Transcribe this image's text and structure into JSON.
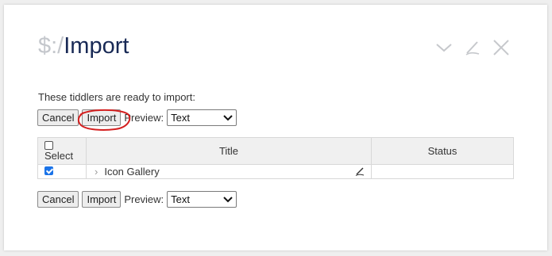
{
  "tiddler": {
    "title_prefix": "$:/",
    "title_name": "Import",
    "intro_text": "These tiddlers are ready to import:"
  },
  "controls": {
    "icons": [
      "chevron-down-icon",
      "edit-icon",
      "close-icon"
    ]
  },
  "toolbar_top": {
    "cancel_label": "Cancel",
    "import_label": "Import",
    "preview_label": "Preview:",
    "preview_value": "Text"
  },
  "toolbar_bottom": {
    "cancel_label": "Cancel",
    "import_label": "Import",
    "preview_label": "Preview:",
    "preview_value": "Text"
  },
  "table": {
    "headers": {
      "select": "Select",
      "title": "Title",
      "status": "Status"
    },
    "rows": [
      {
        "selected": true,
        "title": "Icon Gallery",
        "status": ""
      }
    ]
  },
  "colors": {
    "title": "#182955",
    "annotation": "#d42020",
    "checkbox": "#1a73e8"
  }
}
